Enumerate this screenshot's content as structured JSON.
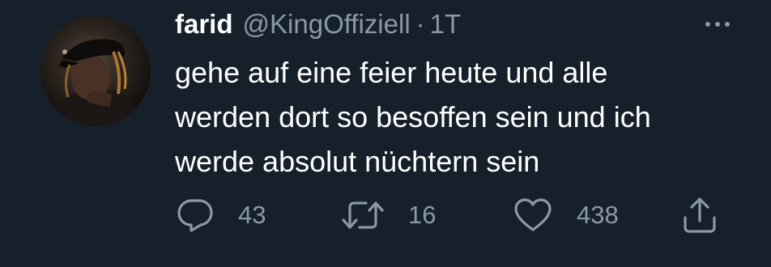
{
  "tweet": {
    "author": {
      "display_name": "farid",
      "handle": "@KingOffiziell",
      "separator": "·",
      "time": "1T"
    },
    "text_lines": [
      "gehe auf eine feier heute und alle",
      "werden dort so besoffen sein und ich",
      "werde absolut nüchtern sein"
    ],
    "actions": {
      "reply": {
        "icon": "reply-icon",
        "count": "43"
      },
      "retweet": {
        "icon": "retweet-icon",
        "count": "16"
      },
      "like": {
        "icon": "heart-icon",
        "count": "438"
      },
      "share": {
        "icon": "share-icon"
      }
    },
    "more": {
      "icon": "more-options-icon"
    }
  },
  "colors": {
    "background": "#15202b",
    "primary_text": "#ffffff",
    "secondary_text": "#8b98a5"
  }
}
